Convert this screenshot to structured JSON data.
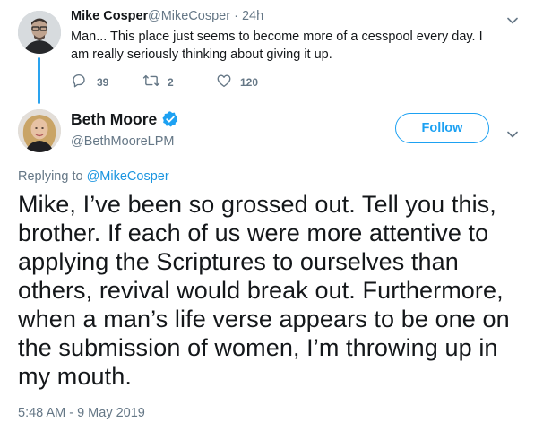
{
  "parent_tweet": {
    "display_name": "Mike Cosper",
    "handle_time": "@MikeCosper · 24h",
    "text": "Man... This place just seems to become more of a cesspool every day. I am really seriously thinking about giving it up.",
    "reply_count": "39",
    "retweet_count": "2",
    "like_count": "120"
  },
  "main_tweet": {
    "display_name": "Beth Moore",
    "handle": "@BethMooreLPM",
    "follow_label": "Follow",
    "replying_prefix": "Replying to",
    "replying_to": "@MikeCosper",
    "text": "Mike, I’ve been so grossed out. Tell you this, brother. If each of us were more attentive to applying the Scriptures to ourselves than others, revival would break out. Furthermore, when a man’s life verse appears to be one on the submission of women, I’m throwing up in my mouth.",
    "timestamp": "5:48 AM - 9 May 2019"
  },
  "colors": {
    "accent": "#1da1f2",
    "link": "#1b95e0",
    "secondary_text": "#657786",
    "primary_text": "#14171a",
    "thread_line": "#2aa3ef"
  },
  "icons": {
    "reply": "reply-icon",
    "retweet": "retweet-icon",
    "like": "heart-icon",
    "verified": "verified-badge-icon",
    "menu": "chevron-down-icon"
  }
}
